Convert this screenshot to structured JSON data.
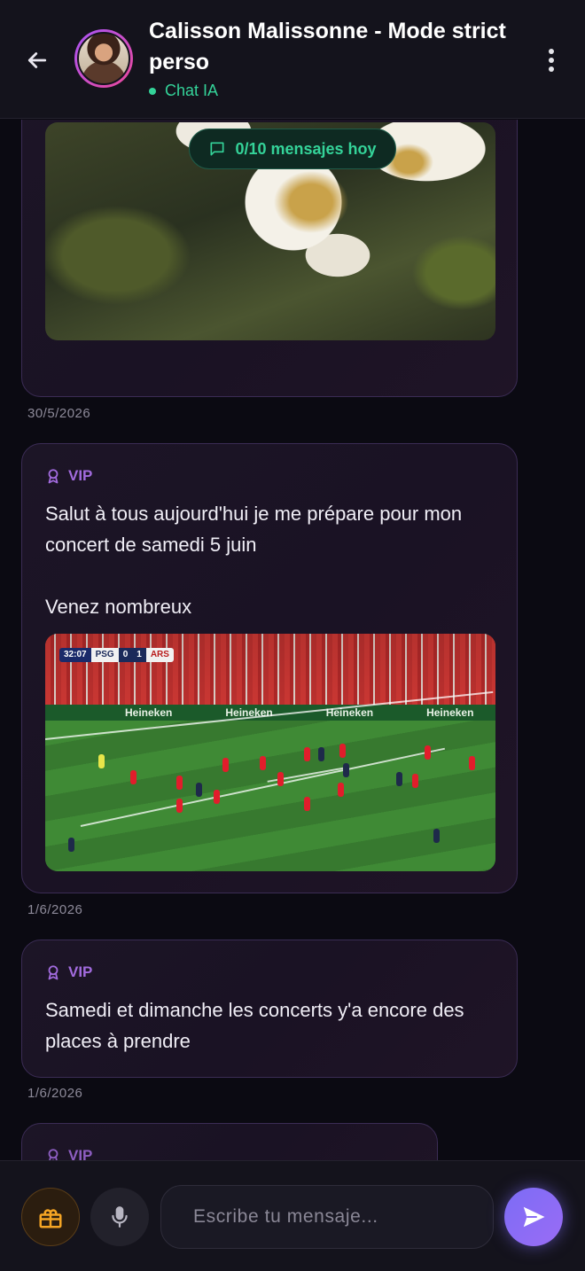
{
  "header": {
    "title": "Calisson Malissonne - Mode strict perso",
    "status": "Chat IA"
  },
  "counter": {
    "label": "0/10 mensajes hoy"
  },
  "messages": [
    {
      "badge": "",
      "text": "",
      "image": "flower",
      "date": "30/5/2026"
    },
    {
      "badge": "VIP",
      "text": "Salut à tous aujourd'hui je me prépare pour mon concert de samedi 5 juin\n\nVenez nombreux",
      "image": "football",
      "date": "1/6/2026",
      "scorebug": {
        "clock": "32:07",
        "home": "PSG",
        "home_score": "0",
        "away_score": "1",
        "away": "ARS"
      },
      "ad_text": "Heineken"
    },
    {
      "badge": "VIP",
      "text": "Samedi et dimanche les concerts y'a encore des places à prendre",
      "date": "1/6/2026"
    },
    {
      "badge": "VIP",
      "text": ""
    }
  ],
  "composer": {
    "placeholder": "Escribe tu mensaje..."
  },
  "colors": {
    "accent": "#a26bde",
    "online": "#34d399",
    "send": "#7c6cf5",
    "gift": "#f5a524"
  }
}
